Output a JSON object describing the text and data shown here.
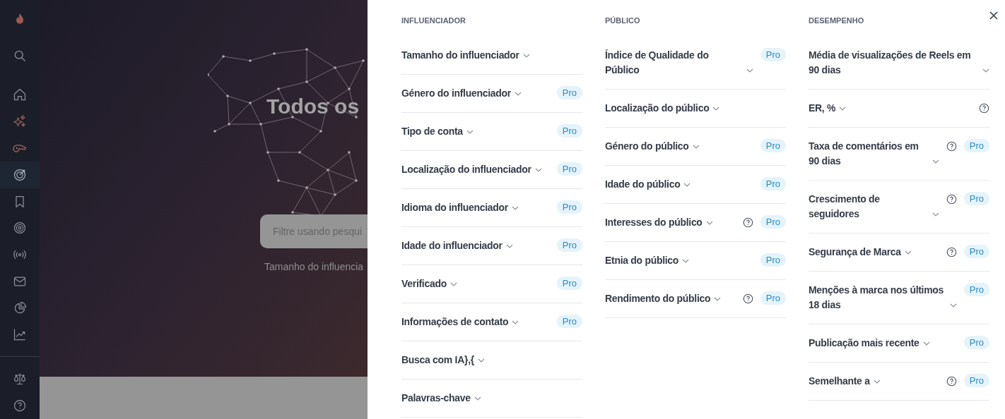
{
  "sidebar": {
    "items": [
      {
        "kind": "logo",
        "selected": false
      },
      {
        "kind": "search",
        "selected": false
      },
      {
        "kind": "home",
        "selected": false
      },
      {
        "kind": "sparkles",
        "selected": false
      },
      {
        "kind": "whistle",
        "selected": false
      },
      {
        "kind": "target-arrow",
        "selected": true
      },
      {
        "kind": "bookmark",
        "selected": false
      },
      {
        "kind": "target",
        "selected": false
      },
      {
        "kind": "broadcast",
        "selected": false
      },
      {
        "kind": "mail",
        "selected": false
      },
      {
        "kind": "pie",
        "selected": false
      },
      {
        "kind": "chart",
        "selected": false
      },
      {
        "kind": "divider",
        "selected": false
      },
      {
        "kind": "scales",
        "selected": false
      },
      {
        "kind": "help",
        "selected": false
      }
    ]
  },
  "main": {
    "title": "Todos os",
    "search": {
      "placeholder": "Filtre usando pesqui"
    },
    "hint": "Tamanho do influencia"
  },
  "filters": {
    "columns": [
      {
        "heading": "INFLUENCIADOR",
        "items": [
          {
            "label": "Tamanho do influenciador",
            "help": false
          },
          {
            "label": "Género do influenciador",
            "help": false,
            "badge": "Pro"
          },
          {
            "label": "Tipo de conta",
            "help": false,
            "badge": "Pro"
          },
          {
            "label": "Localização do influenciador",
            "help": false,
            "badge": "Pro"
          },
          {
            "label": "Idioma do influenciador",
            "help": false,
            "badge": "Pro"
          },
          {
            "label": "Idade do influenciador",
            "help": false,
            "badge": "Pro"
          },
          {
            "label": "Verificado",
            "help": false,
            "badge": "Pro"
          },
          {
            "label": "Informações de contato",
            "help": false,
            "badge": "Pro"
          },
          {
            "label": "Busca com IA},{",
            "help": false
          },
          {
            "label": "Palavras-chave",
            "help": false
          }
        ]
      },
      {
        "heading": "PÚBLICO",
        "items": [
          {
            "label": "Índice de Qualidade do Público",
            "help": false,
            "badge": "Pro"
          },
          {
            "label": "Localização do público",
            "help": false
          },
          {
            "label": "Género do público",
            "help": false,
            "badge": "Pro"
          },
          {
            "label": "Idade do público",
            "help": false,
            "badge": "Pro"
          },
          {
            "label": "Interesses do público",
            "help": true,
            "badge": "Pro"
          },
          {
            "label": "Etnia do público",
            "help": false,
            "badge": "Pro"
          },
          {
            "label": "Rendimento do público",
            "help": true,
            "badge": "Pro"
          }
        ]
      },
      {
        "heading": "DESEMPENHO",
        "items": [
          {
            "label": "Média de visualizações de Reels em 90 dias",
            "help": false
          },
          {
            "label": "ER, %",
            "help": true
          },
          {
            "label": "Taxa de comentários em 90 dias",
            "help": true,
            "badge": "Pro"
          },
          {
            "label": "Crescimento de seguidores",
            "help": true,
            "badge": "Pro"
          },
          {
            "label": "Segurança de Marca",
            "help": true,
            "badge": "Pro"
          },
          {
            "label": "Menções à marca nos últimos 18 dias",
            "help": false,
            "badge": "Pro"
          },
          {
            "label": "Publicação mais recente",
            "help": false,
            "badge": "Pro"
          },
          {
            "label": "Semelhante a",
            "help": true,
            "badge": "Pro"
          }
        ]
      }
    ]
  }
}
